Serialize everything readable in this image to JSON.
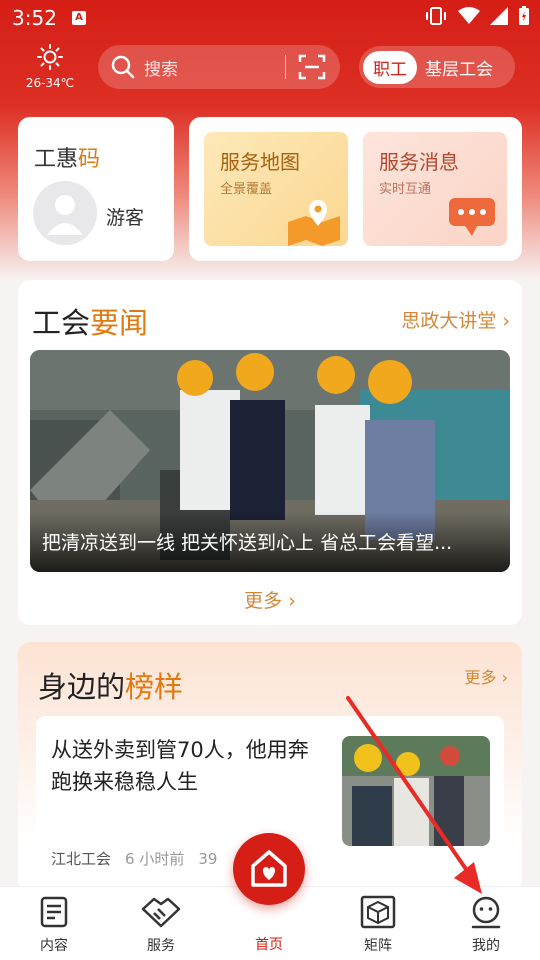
{
  "status": {
    "time": "3:52",
    "app_badge": "A"
  },
  "weather": {
    "temp": "26-34℃",
    "icon": "sun-icon"
  },
  "search": {
    "placeholder": "搜索"
  },
  "toggle": {
    "active": "职工",
    "inactive": "基层工会"
  },
  "gonghuima": {
    "title_a": "工惠",
    "title_b": "码",
    "user": "游客"
  },
  "tiles": [
    {
      "title": "服务地图",
      "subtitle": "全景覆盖"
    },
    {
      "title": "服务消息",
      "subtitle": "实时互通"
    }
  ],
  "news": {
    "title_a": "工会",
    "title_b": "要闻",
    "link": "思政大讲堂",
    "caption": "把清凉送到一线 把关怀送到心上 省总工会看望...",
    "more": "更多"
  },
  "role_models": {
    "title_a": "身边的",
    "title_b": "榜样",
    "more": "更多",
    "item": {
      "title": "从送外卖到管70人，他用奔跑换来稳稳人生",
      "source": "江北工会",
      "time": "6 小时前",
      "extra": "39"
    }
  },
  "nav": [
    {
      "label": "内容",
      "icon": "document-icon"
    },
    {
      "label": "服务",
      "icon": "handshake-icon"
    },
    {
      "label": "首页",
      "icon": "home-heart-icon"
    },
    {
      "label": "矩阵",
      "icon": "cube-icon"
    },
    {
      "label": "我的",
      "icon": "profile-icon"
    }
  ],
  "colors": {
    "brand": "#d51e16",
    "accent": "#e07a10"
  }
}
